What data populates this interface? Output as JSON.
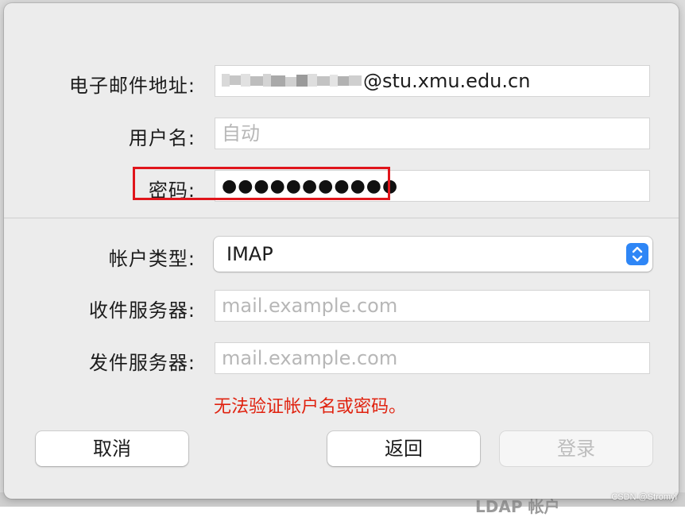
{
  "form": {
    "email_label": "电子邮件地址:",
    "email_value": "@stu.xmu.edu.cn",
    "username_label": "用户名:",
    "username_placeholder": "自动",
    "password_label": "密码:",
    "password_dots": "●●●●●●●●●●●",
    "account_type_label": "帐户类型:",
    "account_type_value": "IMAP",
    "incoming_label": "收件服务器:",
    "incoming_placeholder": "mail.example.com",
    "outgoing_label": "发件服务器:",
    "outgoing_placeholder": "mail.example.com",
    "error_message": "无法验证帐户名或密码。"
  },
  "buttons": {
    "cancel": "取消",
    "back": "返回",
    "login": "登录"
  },
  "background_peek_text": "LDAP 帐户",
  "watermark": "CSDN @Stromyl",
  "colors": {
    "highlight": "#e0151b",
    "error": "#e0220f",
    "accent": "#2e86f6"
  }
}
